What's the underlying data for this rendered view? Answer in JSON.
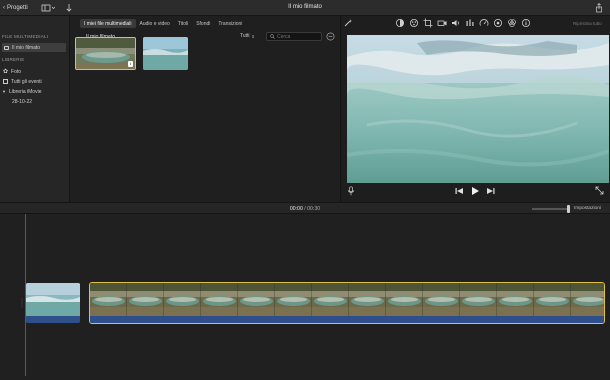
{
  "topbar": {
    "back_label": "Progetti",
    "title": "Il mio filmato"
  },
  "sidebar": {
    "section_media": "FILE MULTIMEDIALI",
    "project_item": "Il mio filmato",
    "section_libraries": "LIBRERIE",
    "photos": "Foto",
    "all_events": "Tutti gli eventi",
    "library": "Libreria iMovie",
    "event_date": "28-10-22"
  },
  "browser": {
    "tabs": [
      {
        "label": "I miei file multimediali",
        "selected": true
      },
      {
        "label": "Audio e video",
        "selected": false
      },
      {
        "label": "Titoli",
        "selected": false
      },
      {
        "label": "Sfondi",
        "selected": false
      },
      {
        "label": "Transizioni",
        "selected": false
      }
    ],
    "title": "Il mio filmato",
    "filter": "Tutti",
    "search_placeholder": "Cerca"
  },
  "viewer": {
    "restore_label": "Ripristina tutto"
  },
  "timeline": {
    "current_time": "00:00",
    "separator": " / ",
    "total_time": "00:30",
    "settings_label": "Impostazioni"
  },
  "colors": {
    "selection": "#e0c040",
    "audio": "#2f4f8c",
    "water": "#7fb7b0"
  }
}
